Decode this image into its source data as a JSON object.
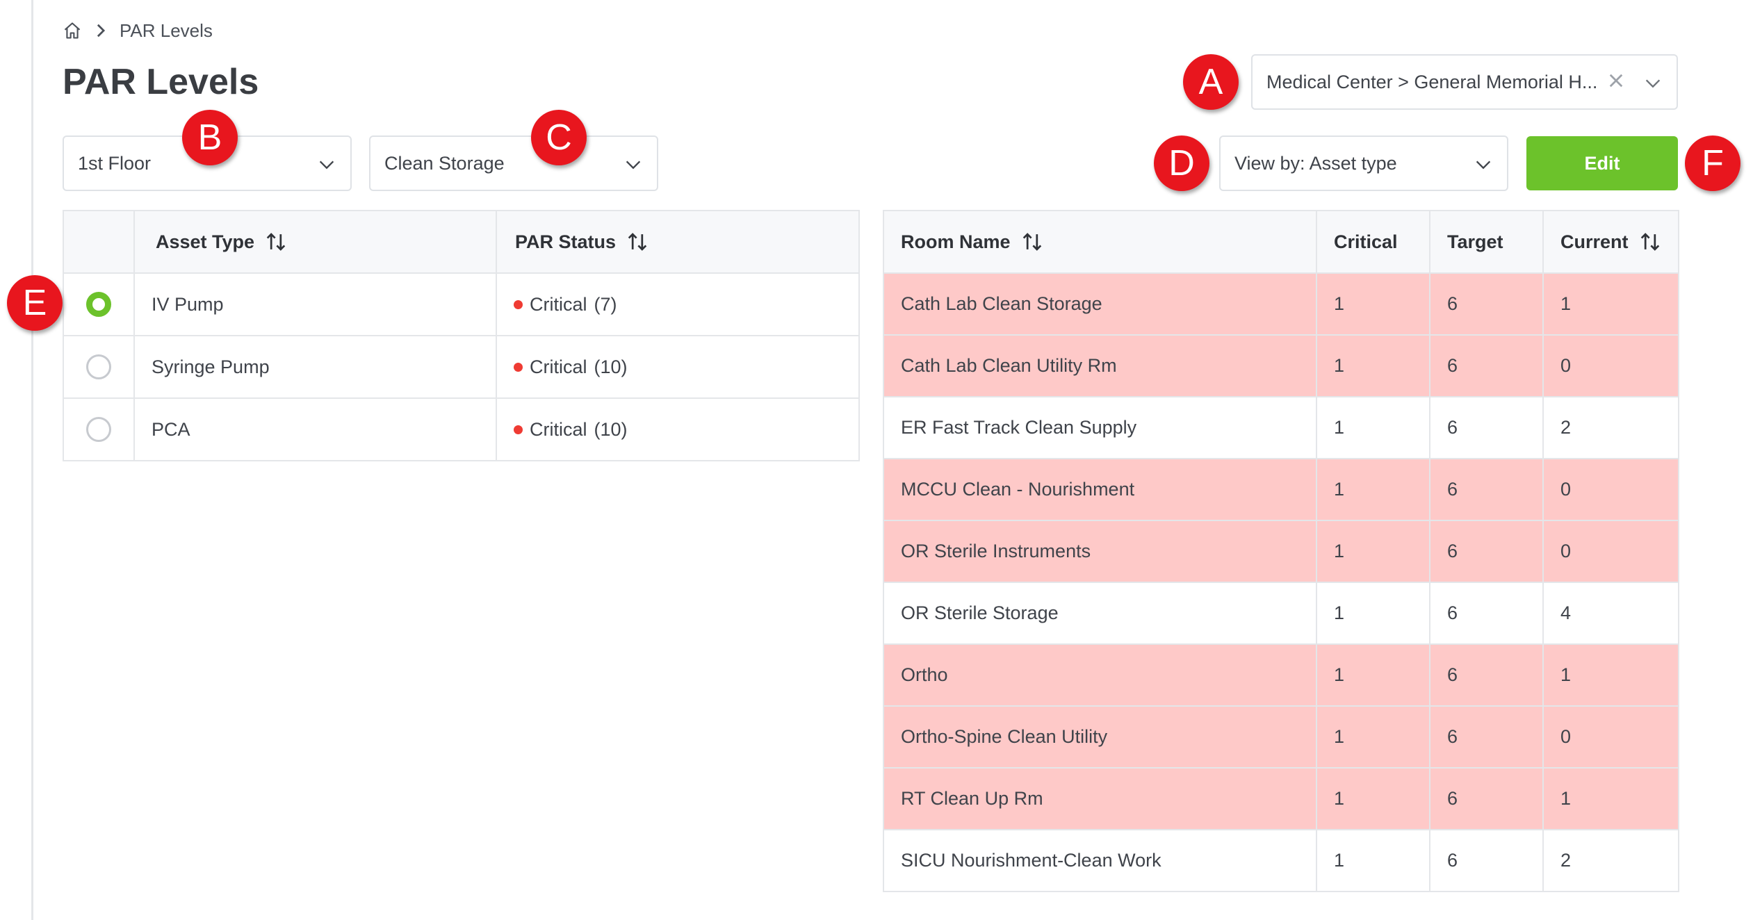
{
  "breadcrumb": {
    "home_icon": "home-icon",
    "separator_icon": "chevron-right-icon",
    "current": "PAR Levels"
  },
  "page_title": "PAR Levels",
  "filters": {
    "site": {
      "value": "Medical Center > General Memorial H...",
      "clear_icon": "close-icon"
    },
    "floor": {
      "value": "1st Floor"
    },
    "department": {
      "value": "Clean Storage"
    },
    "view_by": {
      "value": "View by: Asset type"
    }
  },
  "edit_label": "Edit",
  "asset_table": {
    "headers": {
      "select": "",
      "asset_type": "Asset Type",
      "par_status": "PAR Status"
    },
    "rows": [
      {
        "asset_type": "IV Pump",
        "status": "Critical",
        "count": "(7)",
        "selected": true
      },
      {
        "asset_type": "Syringe Pump",
        "status": "Critical",
        "count": "(10)",
        "selected": false
      },
      {
        "asset_type": "PCA",
        "status": "Critical",
        "count": "(10)",
        "selected": false
      }
    ]
  },
  "room_table": {
    "headers": {
      "room_name": "Room Name",
      "critical": "Critical",
      "target": "Target",
      "current": "Current"
    },
    "rows": [
      {
        "room_name": "Cath Lab Clean Storage",
        "critical": "1",
        "target": "6",
        "current": "1",
        "highlight": true
      },
      {
        "room_name": "Cath Lab Clean Utility Rm",
        "critical": "1",
        "target": "6",
        "current": "0",
        "highlight": true
      },
      {
        "room_name": "ER Fast Track Clean Supply",
        "critical": "1",
        "target": "6",
        "current": "2",
        "highlight": false
      },
      {
        "room_name": "MCCU Clean - Nourishment",
        "critical": "1",
        "target": "6",
        "current": "0",
        "highlight": true
      },
      {
        "room_name": "OR Sterile Instruments",
        "critical": "1",
        "target": "6",
        "current": "0",
        "highlight": true
      },
      {
        "room_name": "OR Sterile Storage",
        "critical": "1",
        "target": "6",
        "current": "4",
        "highlight": false
      },
      {
        "room_name": "Ortho",
        "critical": "1",
        "target": "6",
        "current": "1",
        "highlight": true
      },
      {
        "room_name": "Ortho-Spine Clean Utility",
        "critical": "1",
        "target": "6",
        "current": "0",
        "highlight": true
      },
      {
        "room_name": "RT Clean Up Rm",
        "critical": "1",
        "target": "6",
        "current": "1",
        "highlight": true
      },
      {
        "room_name": "SICU Nourishment-Clean Work",
        "critical": "1",
        "target": "6",
        "current": "2",
        "highlight": false
      }
    ]
  },
  "markers": {
    "a": "A",
    "b": "B",
    "c": "C",
    "d": "D",
    "e": "E",
    "f": "F"
  },
  "colors": {
    "accent_green": "#6cc22b",
    "critical_dot": "#ef3b33",
    "critical_row_bg": "#fec9c8",
    "marker_red": "#e8161e"
  }
}
